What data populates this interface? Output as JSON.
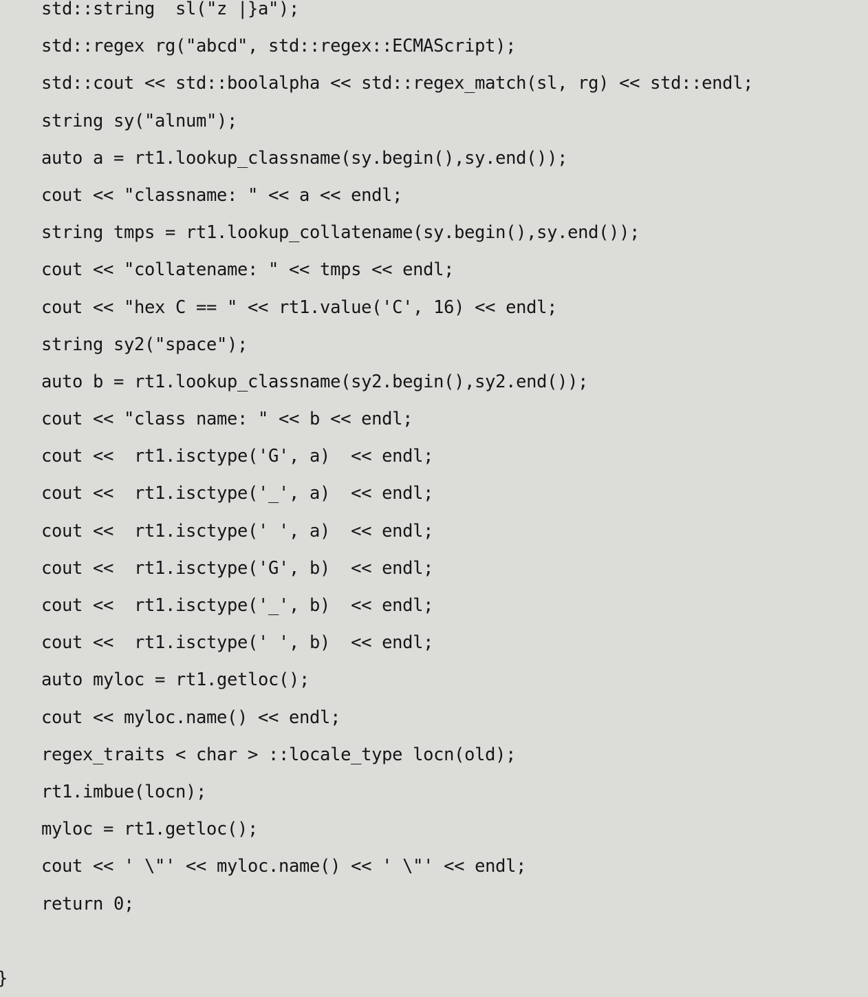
{
  "document": {
    "kind": "source-code-listing",
    "language": "C++",
    "background_color": "#dcdcd8",
    "text_color": "#16161a",
    "lines": [
      "std::string  sl(\"z |}a\");",
      "std::regex rg(\"abcd\", std::regex::ECMAScript);",
      "std::cout << std::boolalpha << std::regex_match(sl, rg) << std::endl;",
      "string sy(\"alnum\");",
      "auto a = rt1.lookup_classname(sy.begin(),sy.end());",
      "cout << \"classname: \" << a << endl;",
      "string tmps = rt1.lookup_collatename(sy.begin(),sy.end());",
      "cout << \"collatename: \" << tmps << endl;",
      "cout << \"hex C == \" << rt1.value('C', 16) << endl;",
      "string sy2(\"space\");",
      "auto b = rt1.lookup_classname(sy2.begin(),sy2.end());",
      "cout << \"class name: \" << b << endl;",
      "cout <<  rt1.isctype('G', a)  << endl;",
      "cout <<  rt1.isctype('_', a)  << endl;",
      "cout <<  rt1.isctype(' ', a)  << endl;",
      "cout <<  rt1.isctype('G', b)  << endl;",
      "cout <<  rt1.isctype('_', b)  << endl;",
      "cout <<  rt1.isctype(' ', b)  << endl;",
      "auto myloc = rt1.getloc();",
      "cout << myloc.name() << endl;",
      "regex_traits < char > ::locale_type locn(old);",
      "rt1.imbue(locn);",
      "myloc = rt1.getloc();",
      "cout << ' \\\"' << myloc.name() << ' \\\"' << endl;",
      "return 0;",
      "",
      "}"
    ]
  }
}
